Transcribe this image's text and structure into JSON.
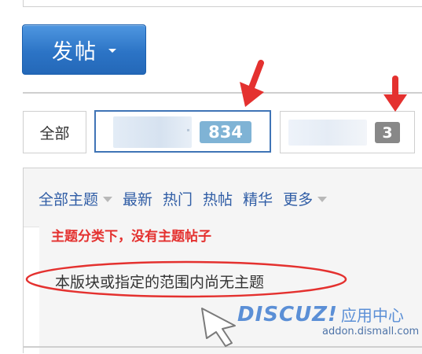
{
  "toolbar": {
    "post_label": "发帖"
  },
  "tabs": [
    {
      "label": "全部"
    },
    {
      "count": "834"
    },
    {
      "count": "3"
    }
  ],
  "filters": {
    "all_topics": "全部主题",
    "latest": "最新",
    "hot": "热门",
    "hot_posts": "热帖",
    "digest": "精华",
    "more": "更多"
  },
  "annotation": "主题分类下，没有主题帖子",
  "empty_message": "本版块或指定的范围内尚无主题",
  "watermark": {
    "brand": "DISCUZ!",
    "subtitle": "应用中心",
    "domain": "addon.dismall.com"
  },
  "colors": {
    "accent": "#2c74c6",
    "link": "#315ea6",
    "annotation": "#e4312f",
    "badge_primary": "#7fb3d5",
    "badge_muted": "#888888"
  }
}
